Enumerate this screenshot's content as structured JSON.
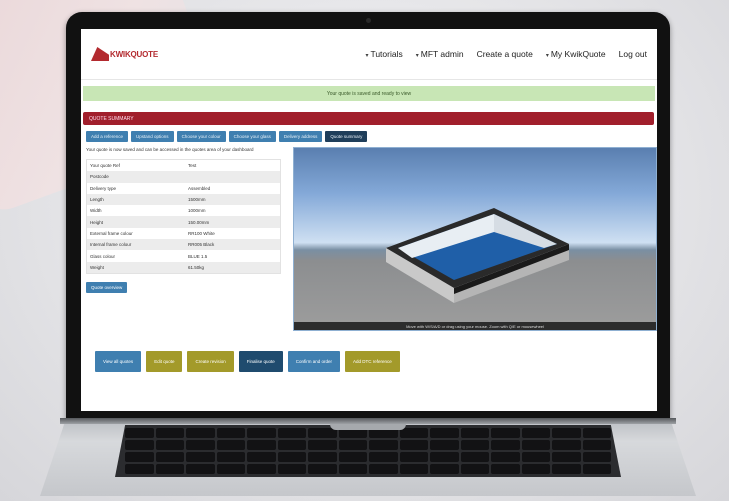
{
  "app": {
    "logo_text": "KWIKQUOTE",
    "nav": [
      {
        "label": "Tutorials",
        "dropdown": true
      },
      {
        "label": "MFT admin",
        "dropdown": true
      },
      {
        "label": "Create a quote",
        "dropdown": false
      },
      {
        "label": "My KwikQuote",
        "dropdown": true
      },
      {
        "label": "Log out",
        "dropdown": false
      }
    ],
    "success_message": "Your quote is saved and ready to view",
    "panel_title": "QUOTE SUMMARY",
    "steps": [
      {
        "label": "Add a reference",
        "active": false
      },
      {
        "label": "Upstand options",
        "active": false
      },
      {
        "label": "Choose your colour",
        "active": false
      },
      {
        "label": "Choose your glass",
        "active": false
      },
      {
        "label": "Delivery address",
        "active": false
      },
      {
        "label": "Quote summary",
        "active": true
      }
    ],
    "intro": "Your quote is now saved and can be accessed in the quotes area of your dashboard",
    "summary": [
      {
        "k": "Your quote Ref",
        "v": "Test"
      },
      {
        "k": "Postcode",
        "v": ""
      },
      {
        "k": "Delivery type",
        "v": "Assembled"
      },
      {
        "k": "Length",
        "v": "1500mm"
      },
      {
        "k": "Width",
        "v": "1000mm"
      },
      {
        "k": "Height",
        "v": "150.00mm"
      },
      {
        "k": "External frame colour",
        "v": "RR100 White"
      },
      {
        "k": "Internal frame colour",
        "v": "RR005 Black"
      },
      {
        "k": "Glass colour",
        "v": "BLUE 1.5"
      },
      {
        "k": "Weight",
        "v": "61.50kg"
      }
    ],
    "overview_button": "Quote overview",
    "viewer_hint": "Move with W/S/A/D or drag using your mouse. Zoom with Q/E or mousewheel",
    "actions": [
      {
        "label": "View all quotes",
        "style": "blue"
      },
      {
        "label": "Edit quote",
        "style": "olive"
      },
      {
        "label": "Create revision",
        "style": "olive"
      },
      {
        "label": "Finalise quote",
        "style": "navy"
      },
      {
        "label": "Confirm and order",
        "style": "blue"
      },
      {
        "label": "Add DTC reference",
        "style": "olive"
      }
    ]
  },
  "colors": {
    "brand_red": "#b32a2f",
    "panel_red": "#a11f2c",
    "step_blue": "#3f7fb0",
    "step_active": "#1f3e5a",
    "olive": "#a39a2a",
    "success_bg": "#c8e6b5"
  },
  "icons": {
    "logo": "kwikquote-logo-icon",
    "dropdown": "caret-down-icon"
  }
}
